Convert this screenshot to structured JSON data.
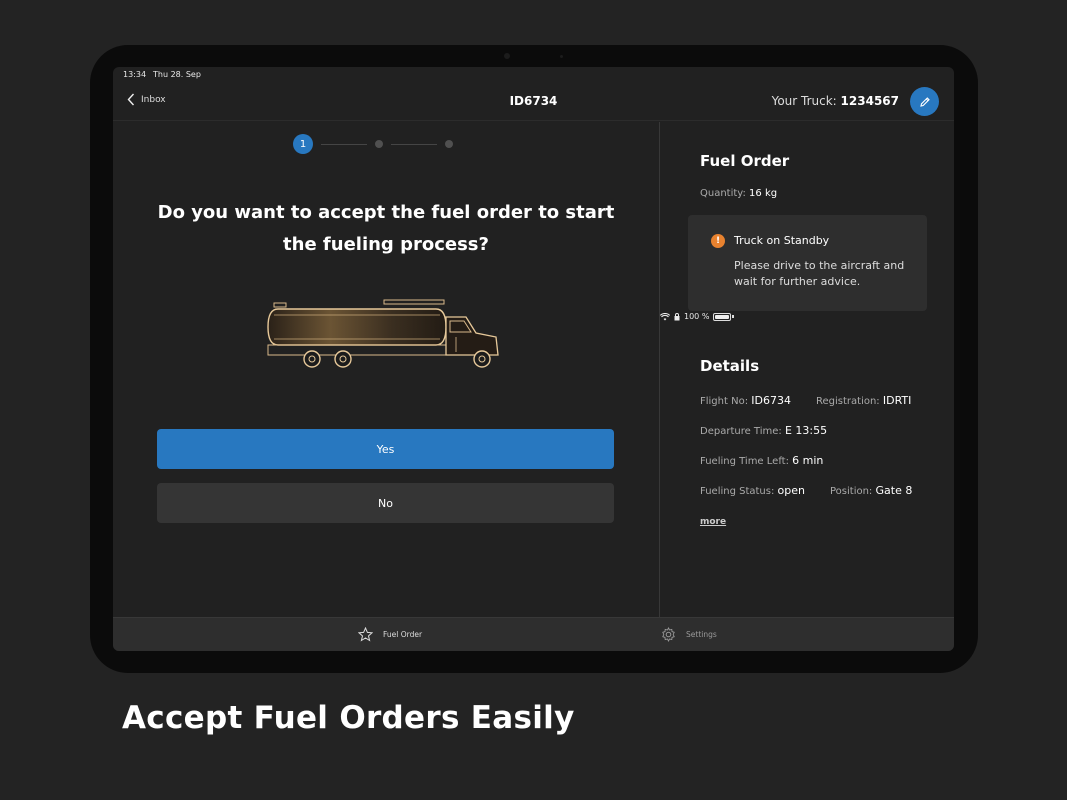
{
  "statusbar": {
    "time": "13:34",
    "date": "Thu 28. Sep",
    "battery": "100 %"
  },
  "navbar": {
    "back_label": "Inbox",
    "title": "ID6734",
    "truck_label": "Your Truck:",
    "truck_id": "1234567"
  },
  "stepper": {
    "current": "1"
  },
  "main": {
    "question": "Do you want to accept the fuel order to start the fueling process?",
    "yes_label": "Yes",
    "no_label": "No"
  },
  "fuel_order": {
    "title": "Fuel Order",
    "quantity_label": "Quantity:",
    "quantity_value": "16 kg",
    "alert_title": "Truck on Standby",
    "alert_text": "Please drive to the aircraft and wait for further advice."
  },
  "details": {
    "title": "Details",
    "flight_label": "Flight No:",
    "flight_value": "ID6734",
    "registration_label": "Registration:",
    "registration_value": "IDRTI",
    "departure_label": "Departure Time:",
    "departure_value": "E 13:55",
    "time_left_label": "Fueling Time Left:",
    "time_left_value": "6 min",
    "status_label": "Fueling Status:",
    "status_value": "open",
    "position_label": "Position:",
    "position_value": "Gate 8",
    "more_label": "more"
  },
  "tabs": {
    "fuel_order": "Fuel Order",
    "settings": "Settings"
  },
  "caption": "Accept Fuel Orders Easily",
  "colors": {
    "accent": "#2878c0",
    "warning": "#e8822f",
    "background": "#212121"
  }
}
